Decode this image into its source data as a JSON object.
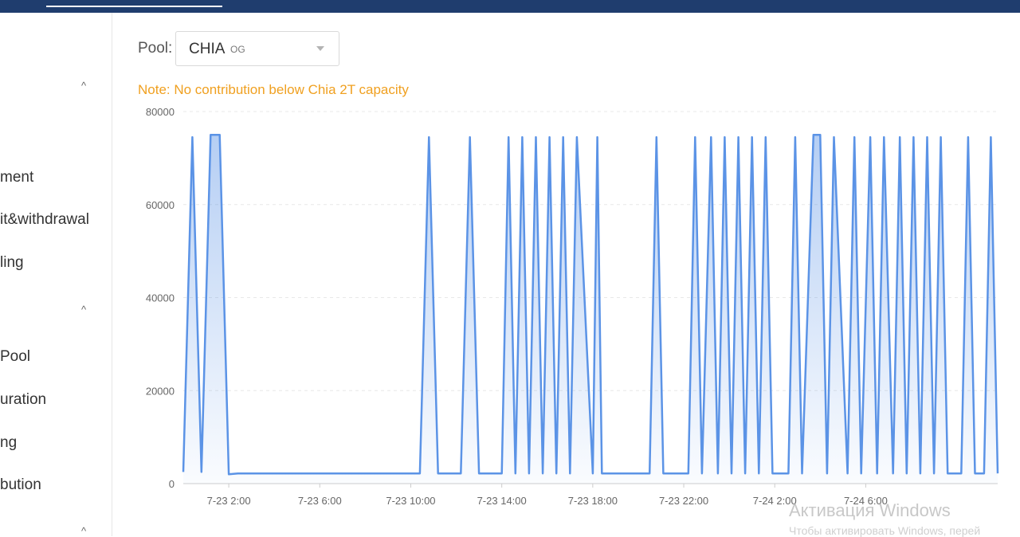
{
  "sidebar": {
    "items": [
      {
        "label": "ment"
      },
      {
        "label": "it&withdrawal"
      },
      {
        "label": "ling"
      },
      {
        "label": "Pool"
      },
      {
        "label": "uration"
      },
      {
        "label": "ng"
      },
      {
        "label": "bution"
      }
    ],
    "chevron": "^"
  },
  "filter": {
    "pool_label": "Pool:",
    "pool_value": "CHIA",
    "pool_suffix": "OG"
  },
  "note": "Note: No contribution below Chia 2T capacity",
  "chart_data": {
    "type": "area",
    "title": "",
    "xlabel": "",
    "ylabel": "",
    "ylim": [
      0,
      80000
    ],
    "yticks": [
      0,
      20000,
      40000,
      60000,
      80000
    ],
    "xticks": [
      "7-23 2:00",
      "7-23 6:00",
      "7-23 10:00",
      "7-23 14:00",
      "7-23 18:00",
      "7-23 22:00",
      "7-24 2:00",
      "7-24 6:00"
    ],
    "grid": true,
    "color": "#5b93e6",
    "x": [
      0,
      0.4,
      0.8,
      1.2,
      1.6,
      2.0,
      2.4,
      3.0,
      10.4,
      10.8,
      11.2,
      12.2,
      12.6,
      13.0,
      14.0,
      14.3,
      14.6,
      14.9,
      15.2,
      15.5,
      15.8,
      16.1,
      16.4,
      16.7,
      17.0,
      17.3,
      18.0,
      18.2,
      18.4,
      20.5,
      20.8,
      21.1,
      22.2,
      22.5,
      22.8,
      23.2,
      23.5,
      23.8,
      24.1,
      24.4,
      24.7,
      25.0,
      25.3,
      25.6,
      25.9,
      26.6,
      26.9,
      27.2,
      27.7,
      28.0,
      28.3,
      28.6,
      29.2,
      29.5,
      29.8,
      30.2,
      30.5,
      30.8,
      31.2,
      31.5,
      31.8,
      32.1,
      32.4,
      32.7,
      33.0,
      33.3,
      33.6,
      34.2,
      34.5,
      34.8,
      35.2,
      35.5,
      35.8
    ],
    "values": [
      2500,
      74500,
      2500,
      75000,
      75000,
      2000,
      2200,
      2200,
      2200,
      74500,
      2200,
      2200,
      74500,
      2200,
      2200,
      74500,
      2200,
      74500,
      2200,
      74500,
      2200,
      74500,
      2200,
      74500,
      2200,
      74500,
      2200,
      74500,
      2200,
      2200,
      74500,
      2200,
      2200,
      74500,
      2200,
      74500,
      2200,
      74500,
      2200,
      74500,
      2200,
      74500,
      2200,
      74500,
      2200,
      2200,
      74500,
      2200,
      75000,
      75000,
      2200,
      74500,
      2200,
      74500,
      2200,
      74500,
      2200,
      74500,
      2200,
      74500,
      2200,
      74500,
      2200,
      74500,
      2200,
      74500,
      2200,
      2200,
      74500,
      2200,
      2200,
      74500,
      2200
    ]
  },
  "watermark": {
    "line1": "Активация Windows",
    "line2": "Чтобы активировать Windows, перей"
  }
}
